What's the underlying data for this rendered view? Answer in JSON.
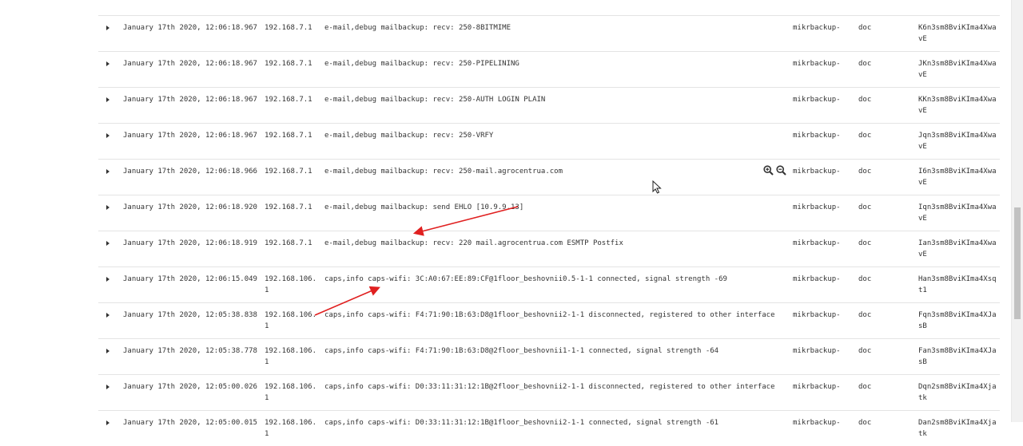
{
  "log_rows": [
    {
      "time": "",
      "host": "",
      "msg": "",
      "sys": "",
      "prog": "",
      "id": "vE"
    },
    {
      "time": "January 17th 2020, 12:06:18.967",
      "host": "192.168.7.1",
      "msg": "e-mail,debug mailbackup: recv: 250-8BITMIME",
      "sys": "mikrbackup-",
      "prog": "doc",
      "id": "K6n3sm8BviKIma4XwavE"
    },
    {
      "time": "January 17th 2020, 12:06:18.967",
      "host": "192.168.7.1",
      "msg": "e-mail,debug mailbackup: recv: 250-PIPELINING",
      "sys": "mikrbackup-",
      "prog": "doc",
      "id": "JKn3sm8BviKIma4XwavE"
    },
    {
      "time": "January 17th 2020, 12:06:18.967",
      "host": "192.168.7.1",
      "msg": "e-mail,debug mailbackup: recv: 250-AUTH LOGIN PLAIN",
      "sys": "mikrbackup-",
      "prog": "doc",
      "id": "KKn3sm8BviKIma4XwavE"
    },
    {
      "time": "January 17th 2020, 12:06:18.967",
      "host": "192.168.7.1",
      "msg": "e-mail,debug mailbackup: recv: 250-VRFY",
      "sys": "mikrbackup-",
      "prog": "doc",
      "id": "Jqn3sm8BviKIma4XwavE"
    },
    {
      "time": "January 17th 2020, 12:06:18.966",
      "host": "192.168.7.1",
      "msg": "e-mail,debug mailbackup: recv: 250-mail.agrocentrua.com",
      "sys": "mikrbackup-",
      "prog": "doc",
      "id": "I6n3sm8BviKIma4XwavE"
    },
    {
      "time": "January 17th 2020, 12:06:18.920",
      "host": "192.168.7.1",
      "msg": "e-mail,debug mailbackup: send EHLO [10.9.9.13]",
      "sys": "mikrbackup-",
      "prog": "doc",
      "id": "Iqn3sm8BviKIma4XwavE"
    },
    {
      "time": "January 17th 2020, 12:06:18.919",
      "host": "192.168.7.1",
      "msg": "e-mail,debug mailbackup: recv: 220 mail.agrocentrua.com ESMTP Postfix",
      "sys": "mikrbackup-",
      "prog": "doc",
      "id": "Ian3sm8BviKIma4XwavE"
    },
    {
      "time": "January 17th 2020, 12:06:15.049",
      "host": "192.168.106.1",
      "msg": "caps,info caps-wifi: 3C:A0:67:EE:89:CF@1floor_beshovnii0.5-1-1 connected, signal strength -69",
      "sys": "mikrbackup-",
      "prog": "doc",
      "id": "Han3sm8BviKIma4Xsqt1"
    },
    {
      "time": "January 17th 2020, 12:05:38.838",
      "host": "192.168.106.1",
      "msg": "caps,info caps-wifi: F4:71:90:1B:63:D8@1floor_beshovnii2-1-1 disconnected, registered to other interface",
      "sys": "mikrbackup-",
      "prog": "doc",
      "id": "Fqn3sm8BviKIma4XJasB"
    },
    {
      "time": "January 17th 2020, 12:05:38.778",
      "host": "192.168.106.1",
      "msg": "caps,info caps-wifi: F4:71:90:1B:63:D8@2floor_beshovnii1-1-1 connected, signal strength -64",
      "sys": "mikrbackup-",
      "prog": "doc",
      "id": "Fan3sm8BviKIma4XJasB"
    },
    {
      "time": "January 17th 2020, 12:05:00.026",
      "host": "192.168.106.1",
      "msg": "caps,info caps-wifi: D0:33:11:31:12:1B@2floor_beshovnii2-1-1 disconnected, registered to other interface",
      "sys": "mikrbackup-",
      "prog": "doc",
      "id": "Dqn2sm8BviKIma4Xjatk"
    },
    {
      "time": "January 17th 2020, 12:05:00.015",
      "host": "192.168.106.1",
      "msg": "caps,info caps-wifi: D0:33:11:31:12:1B@1floor_beshovnii2-1-1 connected, signal strength -61",
      "sys": "mikrbackup-",
      "prog": "doc",
      "id": "Dan2sm8BviKIma4Xjatk"
    }
  ],
  "icons": {
    "expand": "triangle-right-icon",
    "zoom_in": "magnifier-plus-icon",
    "zoom_out": "magnifier-minus-icon",
    "cursor": "mouse-pointer-icon"
  },
  "colors": {
    "annotation_arrow": "#e02020",
    "text": "#333333",
    "row_border": "#e4e4e4"
  }
}
